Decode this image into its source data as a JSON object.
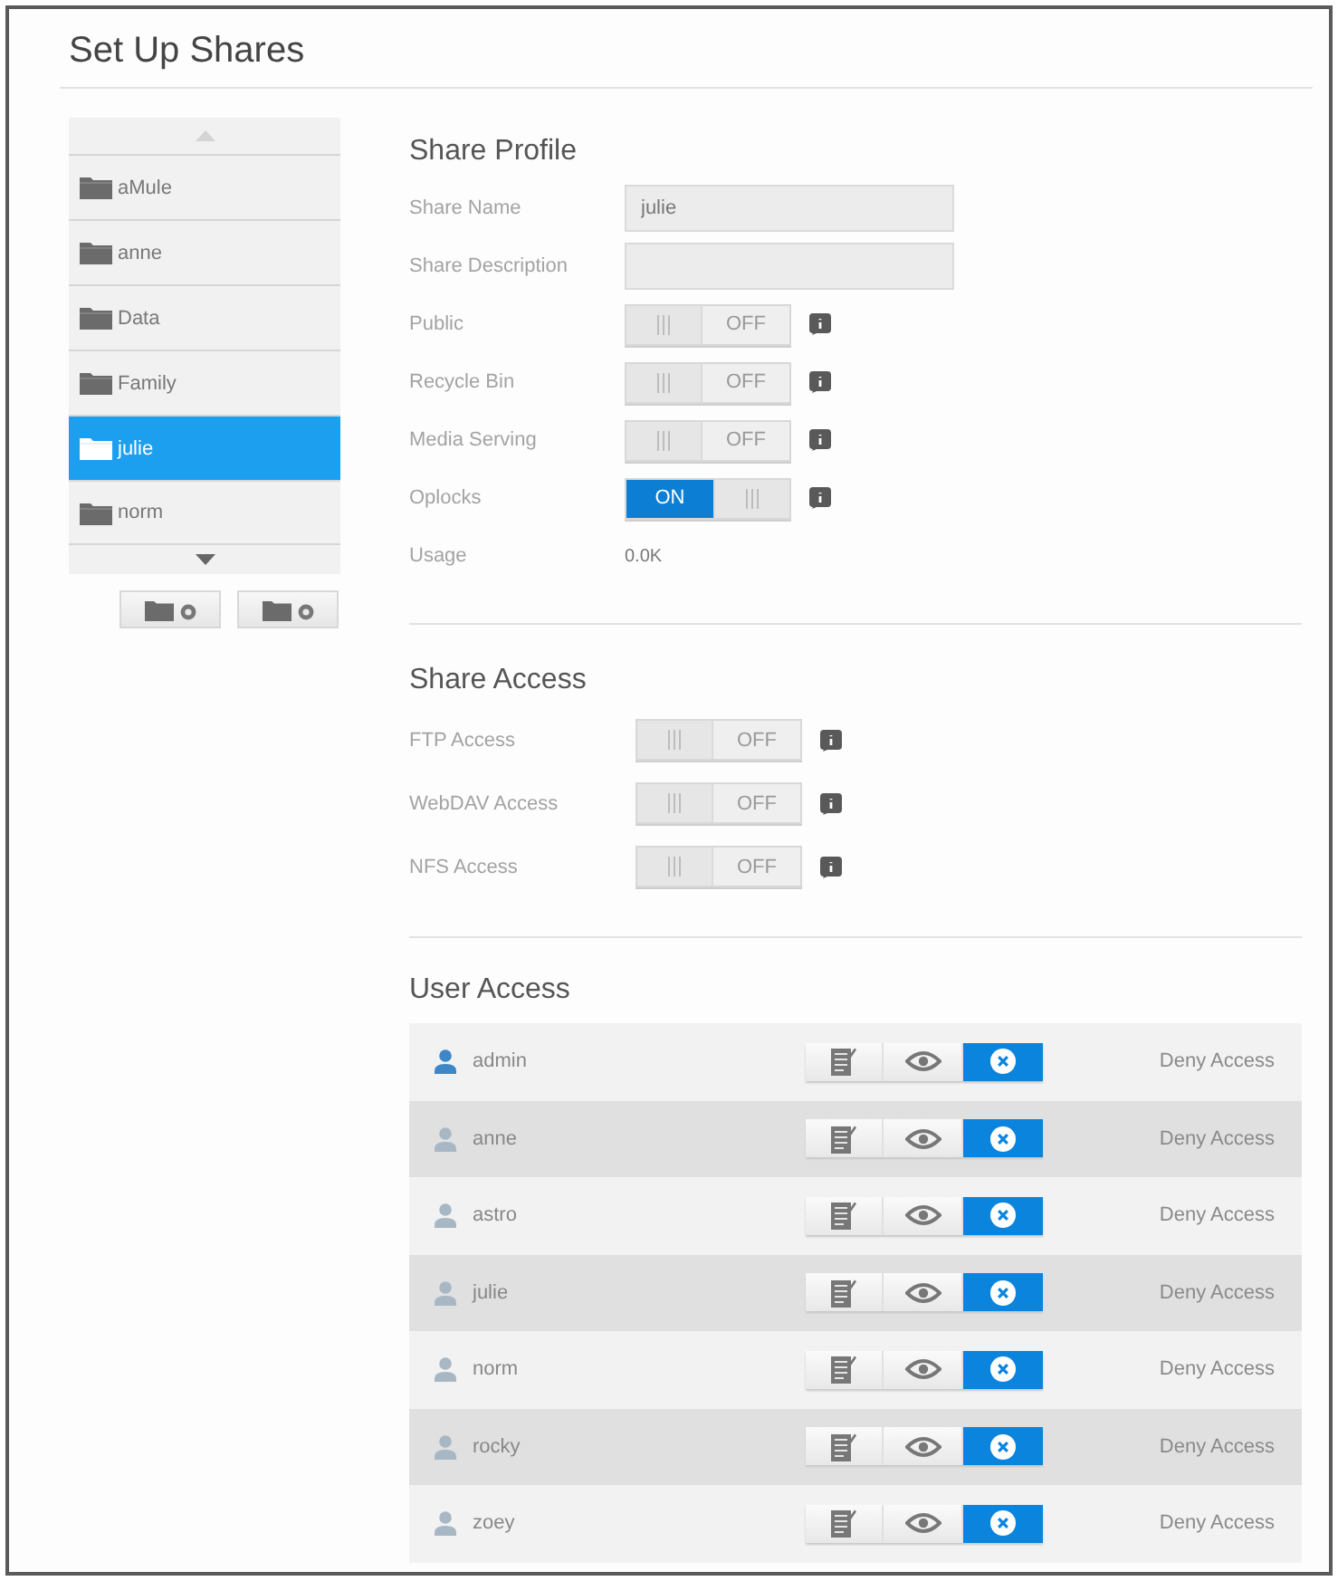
{
  "title": "Set Up Shares",
  "shares": {
    "scroll_up": {
      "disabled": true
    },
    "items": [
      {
        "name": "aMule",
        "selected": false
      },
      {
        "name": "anne",
        "selected": false
      },
      {
        "name": "Data",
        "selected": false
      },
      {
        "name": "Family",
        "selected": false
      },
      {
        "name": "julie",
        "selected": true
      },
      {
        "name": "norm",
        "selected": false
      }
    ],
    "scroll_down": {
      "disabled": false
    }
  },
  "profile": {
    "heading": "Share Profile",
    "fields": [
      {
        "kind": "text",
        "label": "Share Name",
        "value": "julie"
      },
      {
        "kind": "text",
        "label": "Share Description"
      },
      {
        "kind": "toggle",
        "label": "Public",
        "on": false,
        "state_text": "OFF"
      },
      {
        "kind": "toggle",
        "label": "Recycle Bin",
        "on": false,
        "state_text": "OFF"
      },
      {
        "kind": "toggle",
        "label": "Media Serving",
        "on": false,
        "state_text": "OFF"
      },
      {
        "kind": "toggle",
        "label": "Oplocks",
        "on": true,
        "state_text": "ON"
      },
      {
        "kind": "reading",
        "label": "Usage",
        "value": "0.0K"
      }
    ]
  },
  "share_access": {
    "heading": "Share Access",
    "fields": [
      {
        "kind": "toggle",
        "label": "FTP Access",
        "on": false,
        "state_text": "OFF"
      },
      {
        "kind": "toggle",
        "label": "WebDAV Access",
        "on": false,
        "state_text": "OFF"
      },
      {
        "kind": "toggle",
        "label": "NFS Access",
        "on": false,
        "state_text": "OFF"
      }
    ]
  },
  "user_access": {
    "heading": "User Access",
    "users": [
      {
        "name": "admin",
        "kind": "admin",
        "options": [
          {
            "kind": "read-write",
            "selected": false
          },
          {
            "kind": "read-only",
            "selected": false
          },
          {
            "kind": "deny",
            "selected": true
          }
        ],
        "access": "Deny Access"
      },
      {
        "name": "anne",
        "kind": "user",
        "options": [
          {
            "kind": "read-write",
            "selected": false
          },
          {
            "kind": "read-only",
            "selected": false
          },
          {
            "kind": "deny",
            "selected": true
          }
        ],
        "access": "Deny Access"
      },
      {
        "name": "astro",
        "kind": "user",
        "options": [
          {
            "kind": "read-write",
            "selected": false
          },
          {
            "kind": "read-only",
            "selected": false
          },
          {
            "kind": "deny",
            "selected": true
          }
        ],
        "access": "Deny Access"
      },
      {
        "name": "julie",
        "kind": "user",
        "options": [
          {
            "kind": "read-write",
            "selected": false
          },
          {
            "kind": "read-only",
            "selected": false
          },
          {
            "kind": "deny",
            "selected": true
          }
        ],
        "access": "Deny Access"
      },
      {
        "name": "norm",
        "kind": "user",
        "options": [
          {
            "kind": "read-write",
            "selected": false
          },
          {
            "kind": "read-only",
            "selected": false
          },
          {
            "kind": "deny",
            "selected": true
          }
        ],
        "access": "Deny Access"
      },
      {
        "name": "rocky",
        "kind": "user",
        "options": [
          {
            "kind": "read-write",
            "selected": false
          },
          {
            "kind": "read-only",
            "selected": false
          },
          {
            "kind": "deny",
            "selected": true
          }
        ],
        "access": "Deny Access"
      },
      {
        "name": "zoey",
        "kind": "user",
        "options": [
          {
            "kind": "read-write",
            "selected": false
          },
          {
            "kind": "read-only",
            "selected": false
          },
          {
            "kind": "deny",
            "selected": true
          }
        ],
        "access": "Deny Access"
      }
    ]
  }
}
